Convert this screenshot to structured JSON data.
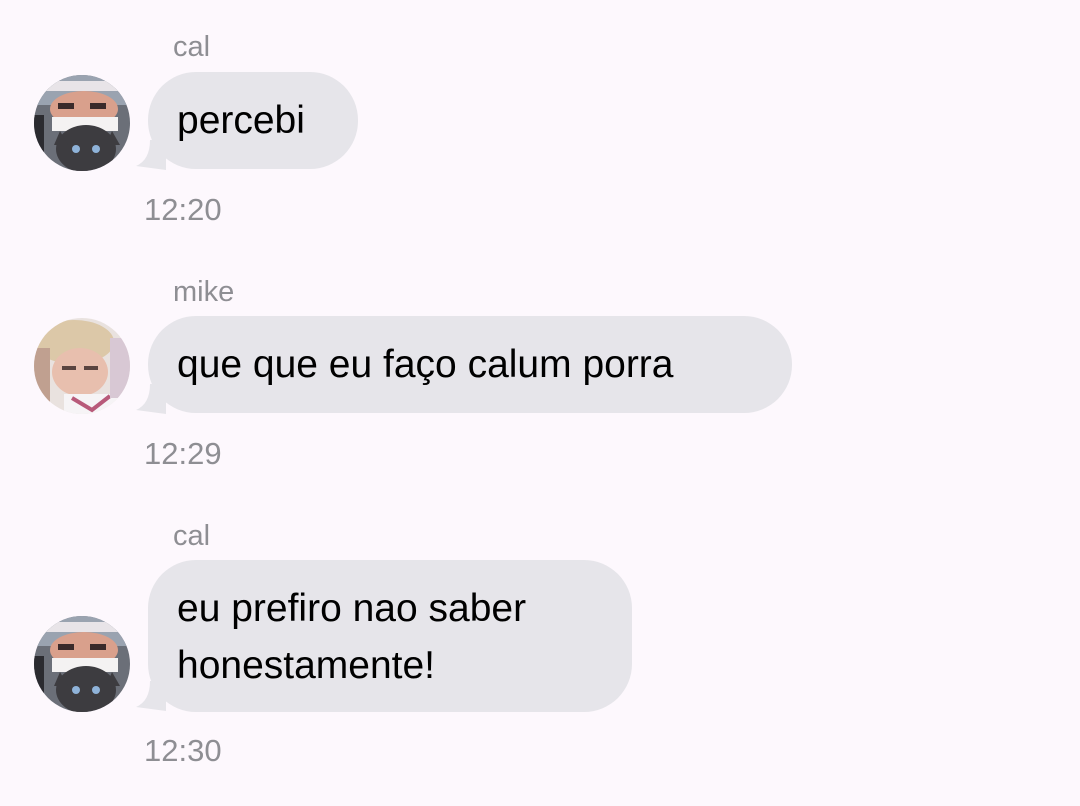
{
  "messages": [
    {
      "sender": "cal",
      "text": "percebi",
      "time": "12:20",
      "avatar_icon": "cal-avatar"
    },
    {
      "sender": "mike",
      "text": "que que eu faço calum porra",
      "time": "12:29",
      "avatar_icon": "mike-avatar"
    },
    {
      "sender": "cal",
      "text": "eu prefiro nao saber\nhonestamente!",
      "time": "12:30",
      "avatar_icon": "cal-avatar"
    }
  ],
  "colors": {
    "background": "#fdf8fd",
    "bubble": "#e6e5ea",
    "meta_text": "#8e8e93",
    "message_text": "#000000"
  }
}
